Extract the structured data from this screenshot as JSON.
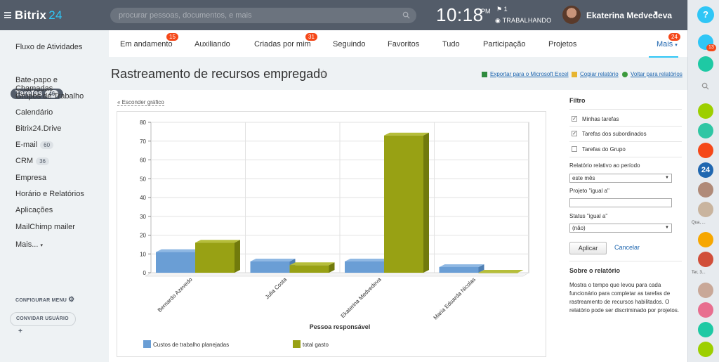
{
  "app": {
    "brand": "Bitrix",
    "brand_num": "24"
  },
  "search": {
    "placeholder": "procurar pessoas, documentos, e mais"
  },
  "header": {
    "time": "10:18",
    "ampm": "PM",
    "flag_count": "1",
    "status": "TRABALHANDO",
    "user_name": "Ekaterina Medvedeva"
  },
  "sidebar": {
    "items": [
      {
        "label": "Fluxo de Atividades"
      },
      {
        "label": "Bate-papo e Chamadas"
      },
      {
        "label": "Grupos de Trabalho"
      },
      {
        "label": "Calendário"
      },
      {
        "label": "Bitrix24.Drive"
      },
      {
        "label": "E-mail",
        "count": "60"
      },
      {
        "label": "CRM",
        "count": "36"
      },
      {
        "label": "Empresa"
      },
      {
        "label": "Horário e Relatórios"
      },
      {
        "label": "Aplicações"
      },
      {
        "label": "MailChimp mailer"
      },
      {
        "label": "Mais..."
      }
    ],
    "active": {
      "label": "Tarefas",
      "count": "46"
    },
    "configure": "CONFIGURAR MENU",
    "invite": "CONVIDAR USUÁRIO"
  },
  "tabs": [
    {
      "label": "Em andamento",
      "badge": "15"
    },
    {
      "label": "Auxiliando"
    },
    {
      "label": "Criadas por mim",
      "badge": "31"
    },
    {
      "label": "Seguindo"
    },
    {
      "label": "Favoritos"
    },
    {
      "label": "Tudo"
    },
    {
      "label": "Participação"
    },
    {
      "label": "Projetos"
    },
    {
      "label": "Mais",
      "badge": "24"
    }
  ],
  "page": {
    "title": "Rastreamento de recursos empregado",
    "export": "Exportar para o Microsoft Excel",
    "copy": "Copiar relatório",
    "back": "Voltar para relatórios",
    "hide_chart": "Esconder gráfico"
  },
  "filter": {
    "title": "Filtro",
    "checks": [
      {
        "label": "Minhas tarefas",
        "checked": true
      },
      {
        "label": "Tarefas dos subordinados",
        "checked": true
      },
      {
        "label": "Tarefas do Grupo",
        "checked": false
      }
    ],
    "period_label": "Relatório relativo ao período",
    "period_value": "este mês",
    "project_label": "Projeto \"igual a\"",
    "project_value": "",
    "status_label": "Status \"igual a\"",
    "status_value": "(não)",
    "apply": "Aplicar",
    "cancel": "Cancelar",
    "about_title": "Sobre o relatório",
    "about_text": "Mostra o tempo que levou para cada funcionário para completar as tarefas de rastreamento de recursos habilitados. O relatório pode ser discriminado por projetos."
  },
  "rightbar": {
    "notif_count": "13",
    "label_qua": "Qua, ...",
    "label_ter": "Ter, 3..."
  },
  "colors": {
    "topbar": "#535c69",
    "accent": "#2fc6f6",
    "badge": "#f54819",
    "series_a": "#6a9ed5",
    "series_b": "#98a114"
  },
  "chart_data": {
    "type": "bar",
    "categories": [
      "Bernardo Azevedo",
      "Julia Costa",
      "Ekaterina Medvedeva",
      "Maria Eduarda Nicolas"
    ],
    "series": [
      {
        "name": "Custos de trabalho planejadas",
        "values": [
          11,
          6,
          6,
          3
        ]
      },
      {
        "name": "total gasto",
        "values": [
          16,
          4,
          73,
          0
        ]
      }
    ],
    "xlabel": "Pessoa responsável",
    "ylabel": "",
    "ylim": [
      0,
      80
    ],
    "yticks": [
      0,
      10,
      20,
      30,
      40,
      50,
      60,
      70,
      80
    ],
    "grid": true,
    "legend": "bottom"
  }
}
